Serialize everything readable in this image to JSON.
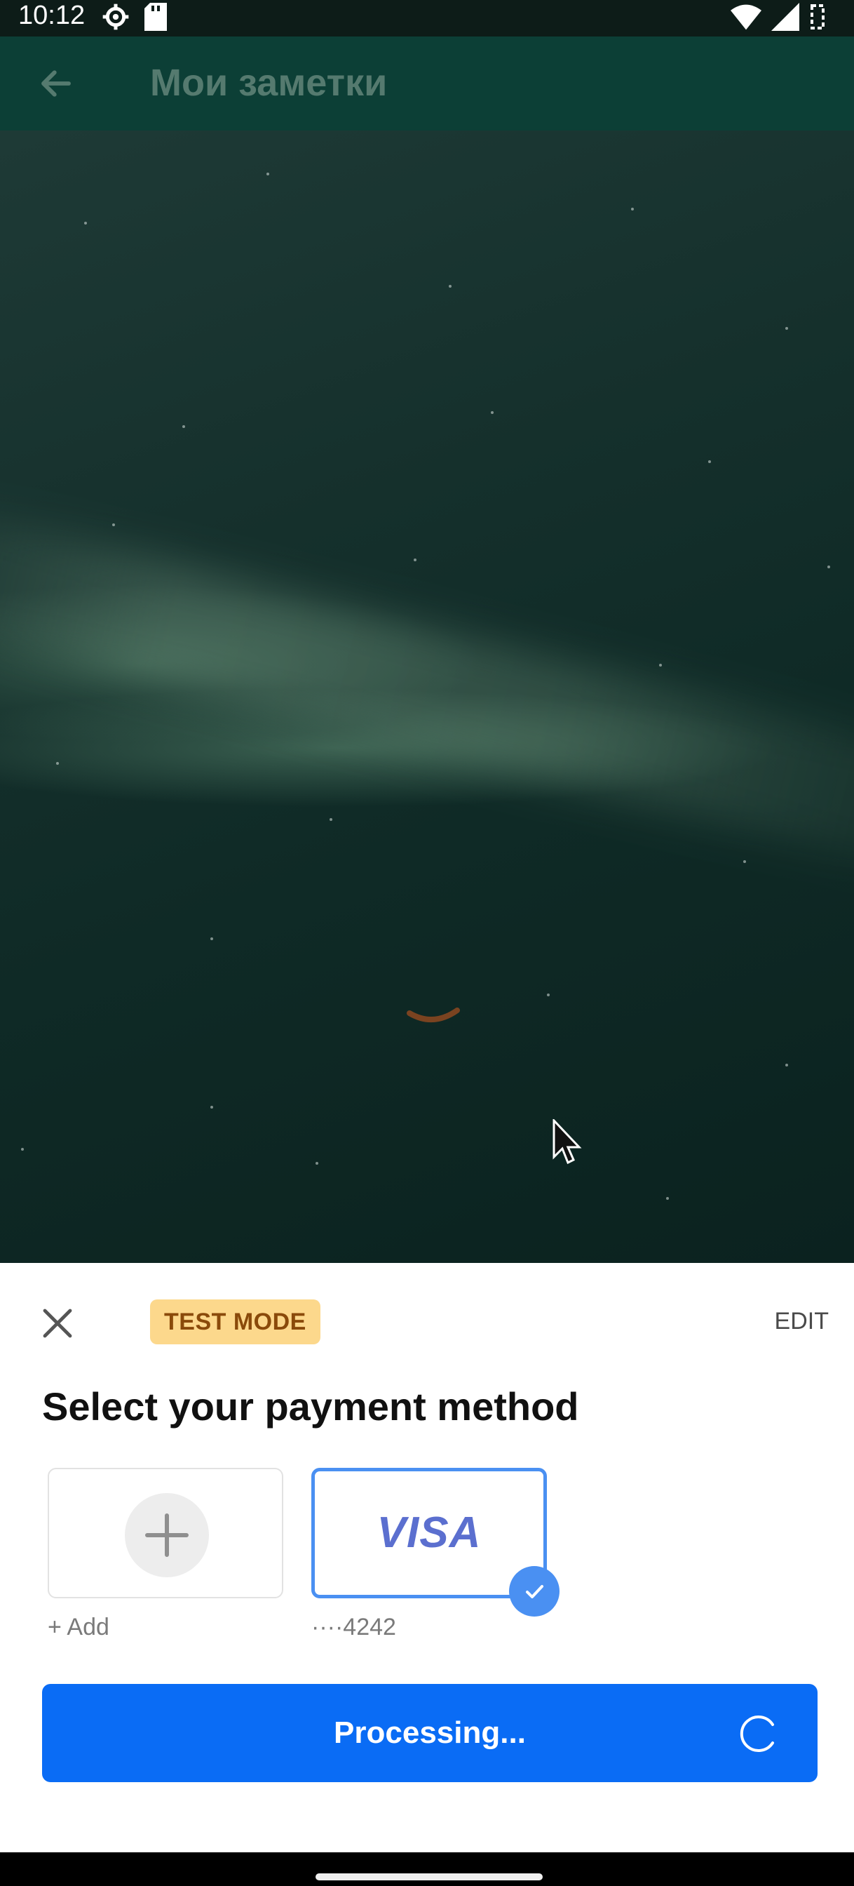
{
  "status_bar": {
    "time": "10:12",
    "left_icons": [
      "settings-icon",
      "sd-card-icon"
    ],
    "right_icons": [
      "wifi-icon",
      "signal-icon",
      "battery-icon"
    ]
  },
  "app_bar": {
    "title": "Мои заметки",
    "back_icon": "arrow-back-icon"
  },
  "payment_sheet": {
    "badge": "TEST MODE",
    "edit_label": "EDIT",
    "title": "Select your payment method",
    "options": [
      {
        "label": "+ Add",
        "icon": "plus-icon",
        "selected": false
      },
      {
        "brand": "VISA",
        "label": "····4242",
        "selected": true
      }
    ],
    "button_label": "Processing..."
  },
  "colors": {
    "app_bar": "#0c3f36",
    "primary_button": "#0a6cf5",
    "badge_bg": "#fcd88c",
    "badge_text": "#8a4a0a",
    "selected_border": "#4a90f2",
    "visa_text": "#5b6fcf"
  }
}
